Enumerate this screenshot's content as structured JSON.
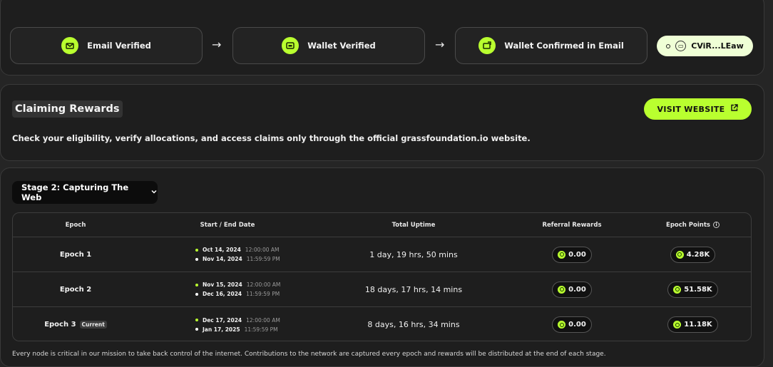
{
  "steps": [
    {
      "label": "Email Verified",
      "icon": "email-icon"
    },
    {
      "label": "Wallet Verified",
      "icon": "wallet-icon"
    },
    {
      "label": "Wallet Confirmed in Email",
      "icon": "wallet-check-icon"
    }
  ],
  "arrows": [
    "→",
    "→"
  ],
  "wallet": {
    "address": "CViR...LEaw"
  },
  "claim": {
    "title": "Claiming Rewards",
    "visit_label": "VISIT WEBSITE",
    "description": "Check your eligibility, verify allocations, and access claims only through the official grassfoundation.io website."
  },
  "stage": {
    "selected": "Stage 2: Capturing The Web"
  },
  "table": {
    "headers": [
      "Epoch",
      "Start / End Date",
      "Total Uptime",
      "Referral Rewards",
      "Epoch Points"
    ],
    "rows": [
      {
        "epoch": "Epoch 1",
        "badge": "",
        "start_date": "Oct 14, 2024",
        "start_time": "12:00:00 AM",
        "end_date": "Nov 14, 2024",
        "end_time": "11:59:59 PM",
        "uptime": "1 day, 19 hrs, 50 mins",
        "referral": "0.00",
        "points": "4.28K"
      },
      {
        "epoch": "Epoch 2",
        "badge": "",
        "start_date": "Nov 15, 2024",
        "start_time": "12:00:00 AM",
        "end_date": "Dec 16, 2024",
        "end_time": "11:59:59 PM",
        "uptime": "18 days, 17 hrs, 14 mins",
        "referral": "0.00",
        "points": "51.58K"
      },
      {
        "epoch": "Epoch 3",
        "badge": "Current",
        "start_date": "Dec 17, 2024",
        "start_time": "12:00:00 AM",
        "end_date": "Jan 17, 2025",
        "end_time": "11:59:59 PM",
        "uptime": "8 days, 16 hrs, 34 mins",
        "referral": "0.00",
        "points": "11.18K"
      }
    ]
  },
  "footnote": "Every node is critical in our mission to take back control of the internet. Contributions to the network are captured every epoch and rewards will be distributed at the end of each stage.",
  "colors": {
    "accent": "#b9ff2f",
    "background": "#252525",
    "card": "#1e1e1e"
  }
}
